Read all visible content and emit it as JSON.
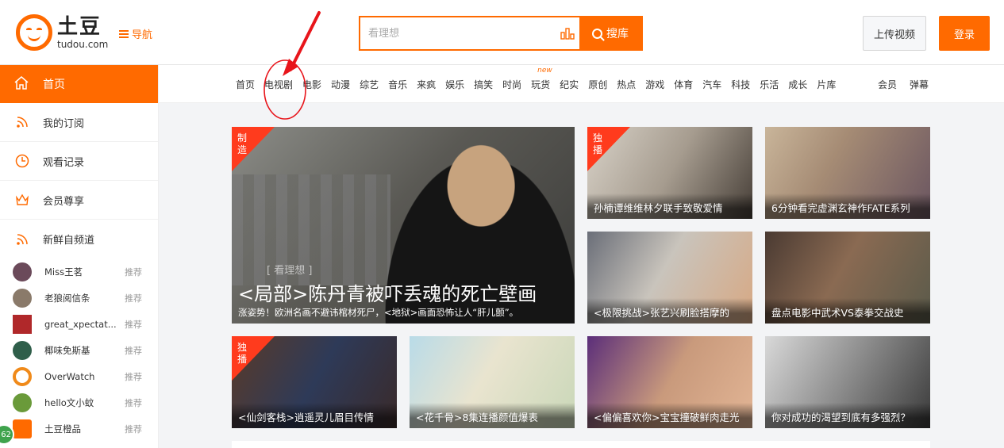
{
  "header": {
    "logo_cn": "土豆",
    "logo_en": "tudou.com",
    "nav_label": "导航",
    "search_placeholder": "看理想",
    "search_button": "搜库",
    "upload_button": "上传视频",
    "login_button": "登录"
  },
  "sidebar": {
    "home": "首页",
    "items": [
      {
        "label": "我的订阅",
        "icon": "rss-icon"
      },
      {
        "label": "观看记录",
        "icon": "clock-icon"
      },
      {
        "label": "会员尊享",
        "icon": "crown-icon"
      },
      {
        "label": "新鲜自频道",
        "icon": "rss-icon"
      }
    ],
    "channels": [
      {
        "name": "Miss王茗",
        "tag": "推荐",
        "color": "#6b4a5a"
      },
      {
        "name": "老狼阅信条",
        "tag": "推荐",
        "color": "#8a7a6a"
      },
      {
        "name": "great_xpectat...",
        "tag": "推荐",
        "color": "#b0282a"
      },
      {
        "name": "椰味免斯基",
        "tag": "推荐",
        "color": "#2f5e4a"
      },
      {
        "name": "OverWatch",
        "tag": "推荐",
        "color": "#f08a1a"
      },
      {
        "name": "hello文小蚊",
        "tag": "推荐",
        "color": "#6a9a3a"
      },
      {
        "name": "土豆橙品",
        "tag": "推荐",
        "color": "#ff6a00"
      }
    ]
  },
  "categories": [
    "首页",
    "电视剧",
    "电影",
    "动漫",
    "综艺",
    "音乐",
    "来疯",
    "娱乐",
    "搞笑",
    "时尚",
    "玩货",
    "纪实",
    "原创",
    "热点",
    "游戏",
    "体育",
    "汽车",
    "科技",
    "乐活",
    "成长",
    "片库"
  ],
  "categories_new_tag": "new",
  "categories_right": [
    "会员",
    "弹幕"
  ],
  "featured": {
    "badge": "制造",
    "title": "<局部>陈丹青被吓丢魂的死亡壁画",
    "subtitle": "涨姿势！欧洲名画不避讳棺材死尸，<地狱>画面恐怖让人“肝儿颤”。",
    "watermark": "[ 看理想 ]"
  },
  "cards": [
    {
      "title": "孙楠谭维维林夕联手致敬爱情",
      "badge": "独播"
    },
    {
      "title": "6分钟看完虚渊玄神作FATE系列",
      "badge": ""
    },
    {
      "title": "<极限挑战>张艺兴刷脸搭摩的",
      "badge": ""
    },
    {
      "title": "盘点电影中武术VS泰拳交战史",
      "badge": ""
    },
    {
      "title": "<仙剑客栈>逍遥灵儿眉目传情",
      "badge": "独播"
    },
    {
      "title": "<花千骨>8集连播颜值爆表",
      "badge": ""
    },
    {
      "title": "<偏偏喜欢你>宝宝撞破鲜肉走光",
      "badge": ""
    },
    {
      "title": "你对成功的渴望到底有多强烈？",
      "badge": ""
    }
  ],
  "float_badge": "62",
  "colors": {
    "accent": "#ff6a00",
    "badge_red": "#ff3b1d",
    "annotation": "#e8151b"
  }
}
